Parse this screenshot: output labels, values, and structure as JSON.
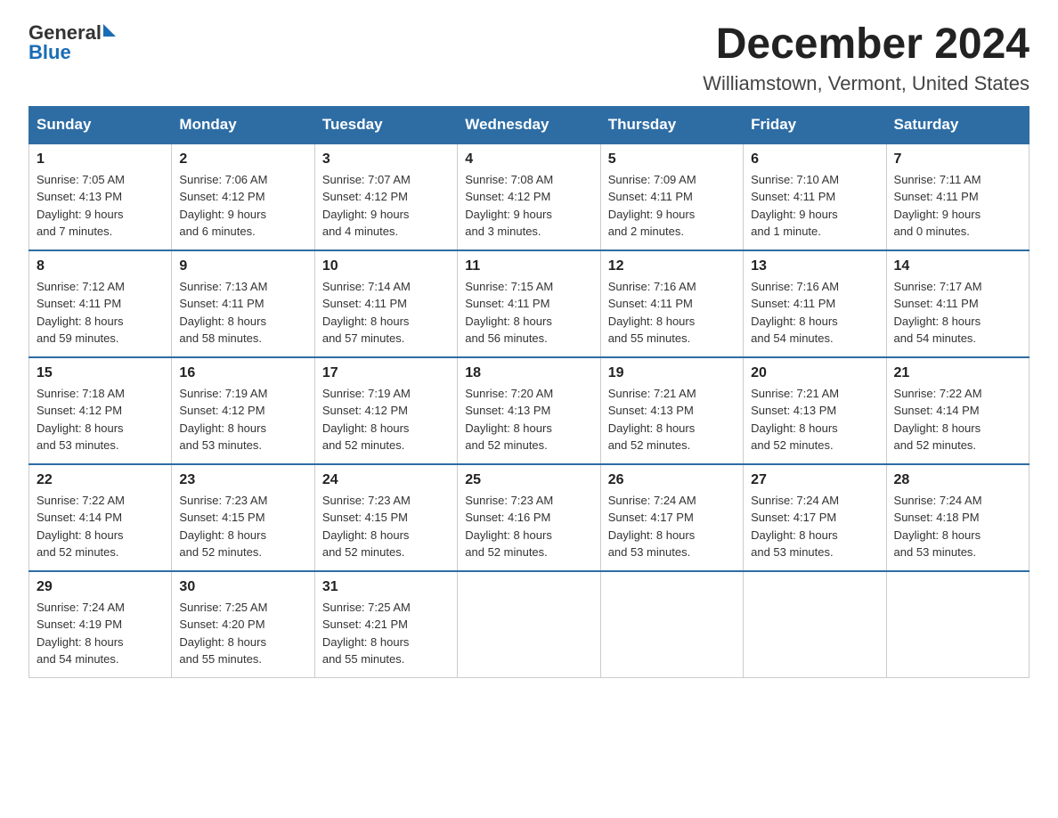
{
  "header": {
    "logo_text_general": "General",
    "logo_text_blue": "Blue",
    "main_title": "December 2024",
    "subtitle": "Williamstown, Vermont, United States"
  },
  "weekdays": [
    "Sunday",
    "Monday",
    "Tuesday",
    "Wednesday",
    "Thursday",
    "Friday",
    "Saturday"
  ],
  "weeks": [
    [
      {
        "day": "1",
        "sunrise": "7:05 AM",
        "sunset": "4:13 PM",
        "daylight": "9 hours and 7 minutes."
      },
      {
        "day": "2",
        "sunrise": "7:06 AM",
        "sunset": "4:12 PM",
        "daylight": "9 hours and 6 minutes."
      },
      {
        "day": "3",
        "sunrise": "7:07 AM",
        "sunset": "4:12 PM",
        "daylight": "9 hours and 4 minutes."
      },
      {
        "day": "4",
        "sunrise": "7:08 AM",
        "sunset": "4:12 PM",
        "daylight": "9 hours and 3 minutes."
      },
      {
        "day": "5",
        "sunrise": "7:09 AM",
        "sunset": "4:11 PM",
        "daylight": "9 hours and 2 minutes."
      },
      {
        "day": "6",
        "sunrise": "7:10 AM",
        "sunset": "4:11 PM",
        "daylight": "9 hours and 1 minute."
      },
      {
        "day": "7",
        "sunrise": "7:11 AM",
        "sunset": "4:11 PM",
        "daylight": "9 hours and 0 minutes."
      }
    ],
    [
      {
        "day": "8",
        "sunrise": "7:12 AM",
        "sunset": "4:11 PM",
        "daylight": "8 hours and 59 minutes."
      },
      {
        "day": "9",
        "sunrise": "7:13 AM",
        "sunset": "4:11 PM",
        "daylight": "8 hours and 58 minutes."
      },
      {
        "day": "10",
        "sunrise": "7:14 AM",
        "sunset": "4:11 PM",
        "daylight": "8 hours and 57 minutes."
      },
      {
        "day": "11",
        "sunrise": "7:15 AM",
        "sunset": "4:11 PM",
        "daylight": "8 hours and 56 minutes."
      },
      {
        "day": "12",
        "sunrise": "7:16 AM",
        "sunset": "4:11 PM",
        "daylight": "8 hours and 55 minutes."
      },
      {
        "day": "13",
        "sunrise": "7:16 AM",
        "sunset": "4:11 PM",
        "daylight": "8 hours and 54 minutes."
      },
      {
        "day": "14",
        "sunrise": "7:17 AM",
        "sunset": "4:11 PM",
        "daylight": "8 hours and 54 minutes."
      }
    ],
    [
      {
        "day": "15",
        "sunrise": "7:18 AM",
        "sunset": "4:12 PM",
        "daylight": "8 hours and 53 minutes."
      },
      {
        "day": "16",
        "sunrise": "7:19 AM",
        "sunset": "4:12 PM",
        "daylight": "8 hours and 53 minutes."
      },
      {
        "day": "17",
        "sunrise": "7:19 AM",
        "sunset": "4:12 PM",
        "daylight": "8 hours and 52 minutes."
      },
      {
        "day": "18",
        "sunrise": "7:20 AM",
        "sunset": "4:13 PM",
        "daylight": "8 hours and 52 minutes."
      },
      {
        "day": "19",
        "sunrise": "7:21 AM",
        "sunset": "4:13 PM",
        "daylight": "8 hours and 52 minutes."
      },
      {
        "day": "20",
        "sunrise": "7:21 AM",
        "sunset": "4:13 PM",
        "daylight": "8 hours and 52 minutes."
      },
      {
        "day": "21",
        "sunrise": "7:22 AM",
        "sunset": "4:14 PM",
        "daylight": "8 hours and 52 minutes."
      }
    ],
    [
      {
        "day": "22",
        "sunrise": "7:22 AM",
        "sunset": "4:14 PM",
        "daylight": "8 hours and 52 minutes."
      },
      {
        "day": "23",
        "sunrise": "7:23 AM",
        "sunset": "4:15 PM",
        "daylight": "8 hours and 52 minutes."
      },
      {
        "day": "24",
        "sunrise": "7:23 AM",
        "sunset": "4:15 PM",
        "daylight": "8 hours and 52 minutes."
      },
      {
        "day": "25",
        "sunrise": "7:23 AM",
        "sunset": "4:16 PM",
        "daylight": "8 hours and 52 minutes."
      },
      {
        "day": "26",
        "sunrise": "7:24 AM",
        "sunset": "4:17 PM",
        "daylight": "8 hours and 53 minutes."
      },
      {
        "day": "27",
        "sunrise": "7:24 AM",
        "sunset": "4:17 PM",
        "daylight": "8 hours and 53 minutes."
      },
      {
        "day": "28",
        "sunrise": "7:24 AM",
        "sunset": "4:18 PM",
        "daylight": "8 hours and 53 minutes."
      }
    ],
    [
      {
        "day": "29",
        "sunrise": "7:24 AM",
        "sunset": "4:19 PM",
        "daylight": "8 hours and 54 minutes."
      },
      {
        "day": "30",
        "sunrise": "7:25 AM",
        "sunset": "4:20 PM",
        "daylight": "8 hours and 55 minutes."
      },
      {
        "day": "31",
        "sunrise": "7:25 AM",
        "sunset": "4:21 PM",
        "daylight": "8 hours and 55 minutes."
      },
      null,
      null,
      null,
      null
    ]
  ],
  "labels": {
    "sunrise": "Sunrise:",
    "sunset": "Sunset:",
    "daylight": "Daylight:"
  }
}
